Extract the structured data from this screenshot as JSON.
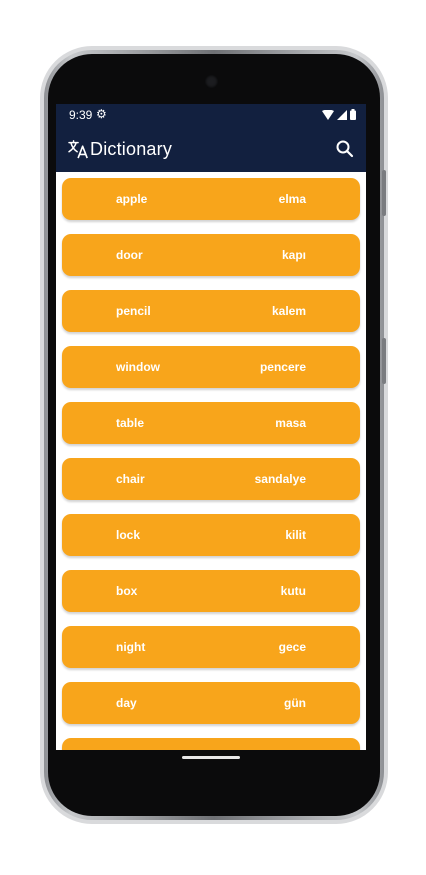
{
  "status_bar": {
    "time": "9:39",
    "settings_icon": "gear-icon",
    "wifi_icon": "wifi-icon",
    "signal_icon": "signal-icon",
    "battery_icon": "battery-icon"
  },
  "app_bar": {
    "icon": "translate-icon",
    "title": "Dictionary",
    "search_icon": "search-icon",
    "background": "#12203f"
  },
  "colors": {
    "row_background": "#f8a51b",
    "row_text": "#ffffff"
  },
  "entries": [
    {
      "word": "apple",
      "translation": "elma"
    },
    {
      "word": "door",
      "translation": "kapı"
    },
    {
      "word": "pencil",
      "translation": "kalem"
    },
    {
      "word": "window",
      "translation": "pencere"
    },
    {
      "word": "table",
      "translation": "masa"
    },
    {
      "word": "chair",
      "translation": "sandalye"
    },
    {
      "word": "lock",
      "translation": "kilit"
    },
    {
      "word": "box",
      "translation": "kutu"
    },
    {
      "word": "night",
      "translation": "gece"
    },
    {
      "word": "day",
      "translation": "gün"
    },
    {
      "word": "",
      "translation": ""
    }
  ]
}
